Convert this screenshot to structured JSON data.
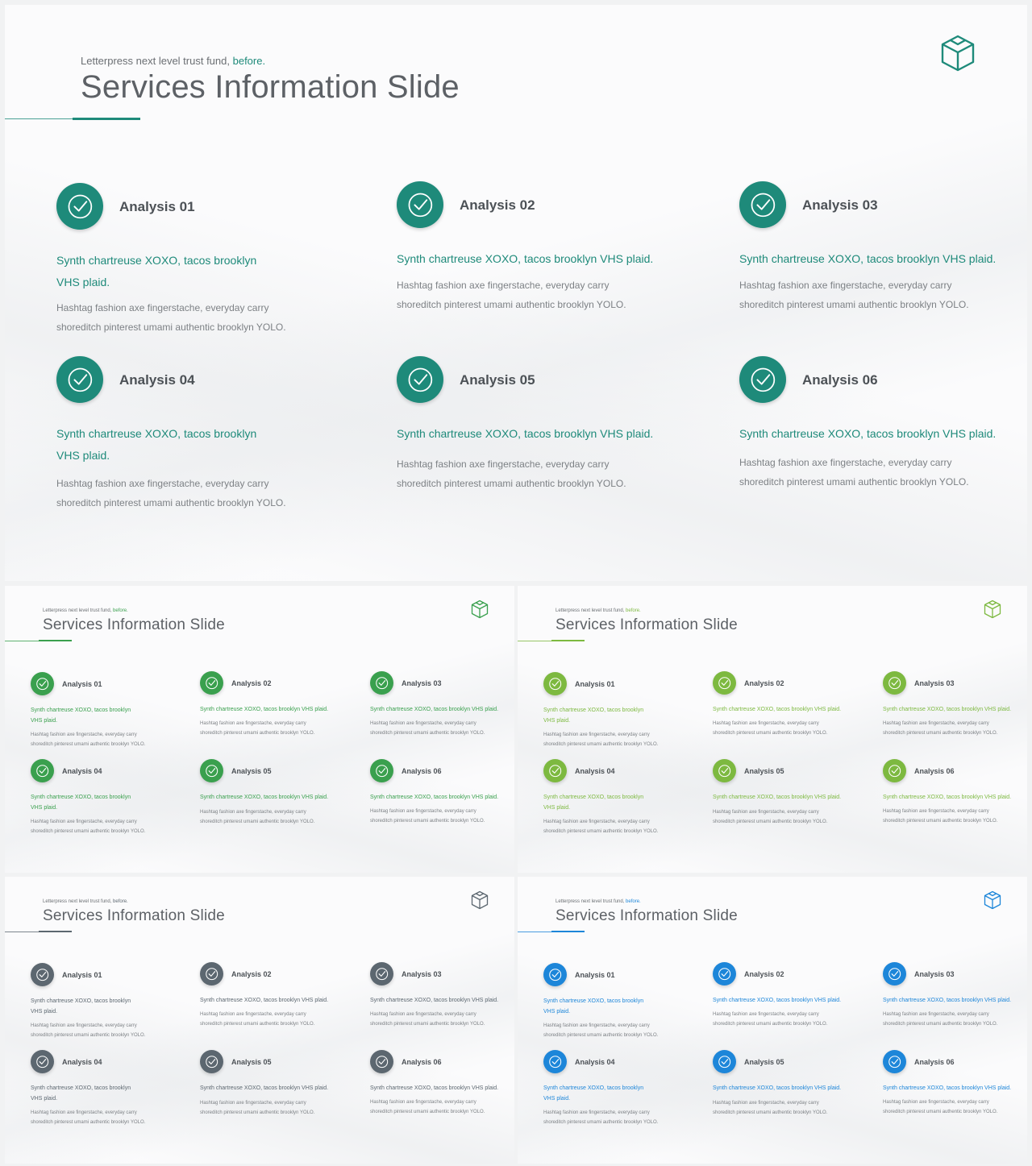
{
  "slide": {
    "subtitle": "Letterpress next level trust fund, ",
    "subtitle_highlight": "before.",
    "title": "Services Information Slide",
    "cards": [
      {
        "title": "Analysis 01",
        "lead": "Synth chartreuse XOXO, tacos brooklyn VHS plaid.",
        "body": "Hashtag fashion axe fingerstache, everyday carry shoreditch pinterest umami authentic brooklyn YOLO."
      },
      {
        "title": "Analysis 02",
        "lead": "Synth chartreuse XOXO, tacos brooklyn VHS plaid.",
        "body": "Hashtag fashion axe fingerstache, everyday carry shoreditch pinterest umami authentic brooklyn YOLO."
      },
      {
        "title": "Analysis 03",
        "lead": "Synth chartreuse XOXO, tacos brooklyn VHS plaid.",
        "body": "Hashtag fashion axe fingerstache, everyday carry shoreditch pinterest umami authentic brooklyn YOLO."
      },
      {
        "title": "Analysis 04",
        "lead": "Synth chartreuse XOXO, tacos brooklyn VHS plaid.",
        "body": "Hashtag fashion axe fingerstache, everyday carry shoreditch pinterest umami authentic brooklyn YOLO."
      },
      {
        "title": "Analysis 05",
        "lead": "Synth chartreuse XOXO, tacos brooklyn VHS plaid.",
        "body": "Hashtag fashion axe fingerstache, everyday carry shoreditch pinterest umami authentic brooklyn YOLO."
      },
      {
        "title": "Analysis 06",
        "lead": "Synth chartreuse XOXO, tacos brooklyn VHS plaid.",
        "body": "Hashtag fashion axe fingerstache, everyday carry shoreditch pinterest umami authentic brooklyn YOLO."
      }
    ]
  },
  "icons": {
    "card": "check-circle-icon",
    "logo": "box-logo-icon"
  },
  "variants": [
    {
      "name": "teal",
      "accent": "#1e8a7a"
    },
    {
      "name": "green",
      "accent": "#3aa04e"
    },
    {
      "name": "lime",
      "accent": "#7db940"
    },
    {
      "name": "slate",
      "accent": "#5c6770"
    },
    {
      "name": "blue",
      "accent": "#1d86d9"
    }
  ]
}
